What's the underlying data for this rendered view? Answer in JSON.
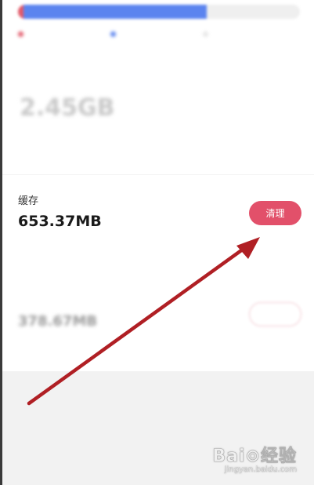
{
  "overview": {
    "legend": [
      {
        "label": "",
        "color": "#e25a6a"
      },
      {
        "label": "",
        "color": "#5b84ef"
      },
      {
        "label": "",
        "color": "#e6e6e6"
      }
    ],
    "label": "",
    "value": "2.45GB",
    "description": "",
    "usage": {
      "red_fraction": 0.02,
      "blue_fraction": 0.65
    }
  },
  "cache": {
    "title": "缓存",
    "value": "653.37MB",
    "description": "",
    "button_label": "清理"
  },
  "downloads": {
    "title": "",
    "value": "378.67MB",
    "description": "",
    "button_label": ""
  },
  "watermark": {
    "main": "Bai⊙经验",
    "sub": "jingyan.baidu.com"
  },
  "colors": {
    "accent": "#e2506a",
    "annotation_arrow": "#b01f24",
    "usage_blue": "#5b84ef",
    "usage_red": "#e25a6a"
  }
}
